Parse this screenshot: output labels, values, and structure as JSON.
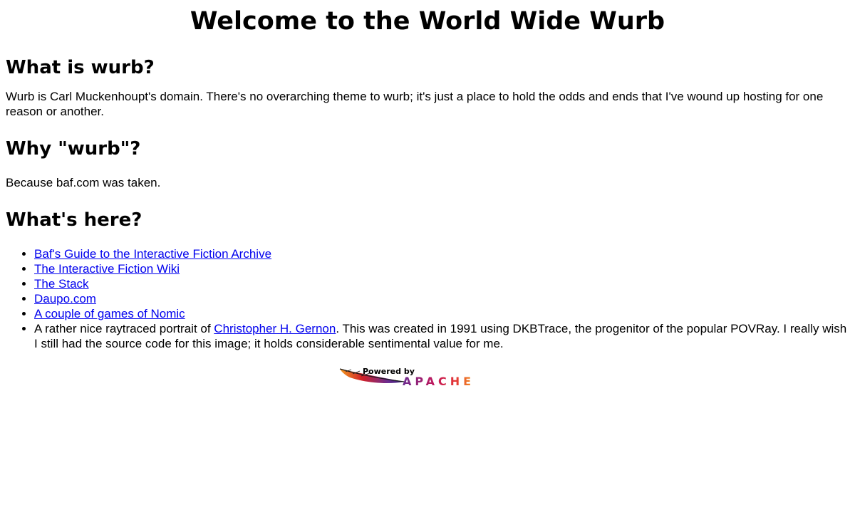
{
  "page": {
    "title": "Welcome to the World Wide Wurb"
  },
  "sections": [
    {
      "heading": "What is wurb?",
      "body": "Wurb is Carl Muckenhoupt's domain. There's no overarching theme to wurb; it's just a place to hold the odds and ends that I've wound up hosting for one reason or another."
    },
    {
      "heading": "Why \"wurb\"?",
      "body": "Because baf.com was taken."
    },
    {
      "heading": "What's here?"
    }
  ],
  "links": [
    {
      "label": "Baf's Guide to the Interactive Fiction Archive"
    },
    {
      "label": "The Interactive Fiction Wiki"
    },
    {
      "label": "The Stack"
    },
    {
      "label": "Daupo.com"
    },
    {
      "label": "A couple of games of Nomic"
    }
  ],
  "portrait_item": {
    "prefix": "A rather nice raytraced portrait of ",
    "link_label": "Christopher H. Gernon",
    "suffix": ". This was created in 1991 using DKBTrace, the progenitor of the popular POVRay. I really wish I still had the source code for this image; it holds considerable sentimental value for me."
  },
  "badge": {
    "line1": "Powered by",
    "line2": "APACHE",
    "icon": "apache-feather-icon"
  },
  "colors": {
    "text": "#000000",
    "link": "#0000ee",
    "background": "#ffffff",
    "feather_red": "#d22128",
    "feather_purple": "#6b2c91",
    "feather_orange": "#f29a1f"
  }
}
